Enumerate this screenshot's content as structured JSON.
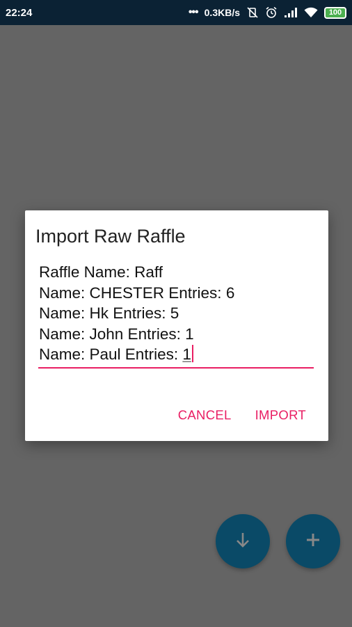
{
  "status_bar": {
    "time": "22:24",
    "dots": "•••",
    "network_speed": "0.3KB/s",
    "battery": "100",
    "icons": [
      "vibrate-off-icon",
      "alarm-icon",
      "signal-icon",
      "wifi-icon",
      "battery-icon"
    ]
  },
  "dialog": {
    "title": "Import Raw Raffle",
    "input_lines": [
      "Raffle Name: Raff",
      "Name: CHESTER Entries: 6",
      "Name: Hk Entries: 5",
      "Name: John Entries: 1"
    ],
    "last_line_prefix": "Name: Paul Entries: ",
    "last_line_value": "1",
    "cancel_label": "CANCEL",
    "import_label": "IMPORT"
  },
  "fabs": {
    "download_icon": "arrow-down-icon",
    "add_icon": "plus-icon"
  },
  "colors": {
    "accent": "#e91e63",
    "fab": "#0a4a67",
    "status_bar": "#0b2234",
    "scrim": "#646464"
  }
}
